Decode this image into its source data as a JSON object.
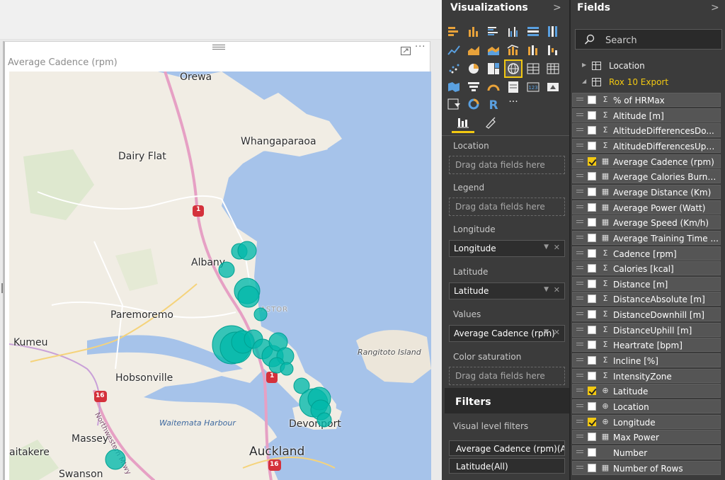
{
  "visual": {
    "title": "Average Cadence (rpm)",
    "more": "···"
  },
  "map": {
    "labels": {
      "orewa": "Orewa",
      "whangaparaoa": "Whangaparaoa",
      "dairy_flat": "Dairy Flat",
      "albany": "Albany",
      "paremoremo": "Paremoremo",
      "kumeu": "Kumeu",
      "hobsonville": "Hobsonville",
      "massey": "Massey",
      "waitakere": "aitakere",
      "swanson": "Swanson",
      "auckland": "Auckland",
      "devonport": "Devonport",
      "waitemata": "Waitemata Harbour",
      "rangitoto": "Rangitoto Island",
      "northwestern": "Northwestern Mtwy",
      "astor": "ASTOR",
      "shield_1a": "1",
      "shield_1b": "1",
      "shield_16a": "16",
      "shield_16b": "16"
    },
    "bubble_color": "#01b8aa"
  },
  "viz_pane": {
    "title": "Visualizations",
    "chevron": ">",
    "selected_icon": "map-visual-icon",
    "tabs": [
      "fields-tab",
      "format-tab"
    ],
    "wells": {
      "location": {
        "label": "Location",
        "placeholder": "Drag data fields here"
      },
      "legend": {
        "label": "Legend",
        "placeholder": "Drag data fields here"
      },
      "longitude": {
        "label": "Longitude",
        "value": "Longitude"
      },
      "latitude": {
        "label": "Latitude",
        "value": "Latitude"
      },
      "values": {
        "label": "Values",
        "value": "Average Cadence (rpm)"
      },
      "color_saturation": {
        "label": "Color saturation",
        "placeholder": "Drag data fields here"
      }
    },
    "dropdown_glyph": "▼",
    "remove_glyph": "✕",
    "filters": {
      "title": "Filters",
      "visual_level_label": "Visual level filters",
      "items": [
        "Average Cadence (rpm)(All)",
        "Latitude(All)"
      ]
    },
    "more_label": "···",
    "r_label": "R",
    "kpi_label": "123"
  },
  "fields_pane": {
    "title": "Fields",
    "chevron": ">",
    "search_placeholder": "Search",
    "tables": [
      {
        "name": "Location",
        "expanded": false
      },
      {
        "name": "Rox 10 Export",
        "expanded": true
      }
    ],
    "fields": [
      {
        "name": "% of HRMax",
        "type": "sigma",
        "checked": false
      },
      {
        "name": "Altitude [m]",
        "type": "sigma",
        "checked": false
      },
      {
        "name": "AltitudeDifferencesDo...",
        "type": "sigma",
        "checked": false
      },
      {
        "name": "AltitudeDifferencesUph...",
        "type": "sigma",
        "checked": false
      },
      {
        "name": "Average Cadence (rpm)",
        "type": "calc",
        "checked": true
      },
      {
        "name": "Average Calories Burnt ...",
        "type": "calc",
        "checked": false
      },
      {
        "name": "Average Distance (Km)",
        "type": "calc",
        "checked": false
      },
      {
        "name": "Average Power (Watt)",
        "type": "calc",
        "checked": false
      },
      {
        "name": "Average Speed (Km/h)",
        "type": "calc",
        "checked": false
      },
      {
        "name": "Average Training Time ...",
        "type": "calc",
        "checked": false
      },
      {
        "name": "Cadence [rpm]",
        "type": "sigma",
        "checked": false
      },
      {
        "name": "Calories [kcal]",
        "type": "sigma",
        "checked": false
      },
      {
        "name": "Distance [m]",
        "type": "sigma",
        "checked": false
      },
      {
        "name": "DistanceAbsolute [m]",
        "type": "sigma",
        "checked": false
      },
      {
        "name": "DistanceDownhill [m]",
        "type": "sigma",
        "checked": false
      },
      {
        "name": "DistanceUphill [m]",
        "type": "sigma",
        "checked": false
      },
      {
        "name": "Heartrate [bpm]",
        "type": "sigma",
        "checked": false
      },
      {
        "name": "Incline [%]",
        "type": "sigma",
        "checked": false
      },
      {
        "name": "IntensityZone",
        "type": "sigma",
        "checked": false
      },
      {
        "name": "Latitude",
        "type": "globe",
        "checked": true
      },
      {
        "name": "Location",
        "type": "globe",
        "checked": false
      },
      {
        "name": "Longitude",
        "type": "globe",
        "checked": true
      },
      {
        "name": "Max Power",
        "type": "calc",
        "checked": false
      },
      {
        "name": "Number",
        "type": "none",
        "checked": false
      },
      {
        "name": "Number of Rows",
        "type": "calc",
        "checked": false
      }
    ],
    "glyphs": {
      "sigma": "Σ",
      "globe": "⊕",
      "calc": "▦",
      "none": ""
    }
  }
}
